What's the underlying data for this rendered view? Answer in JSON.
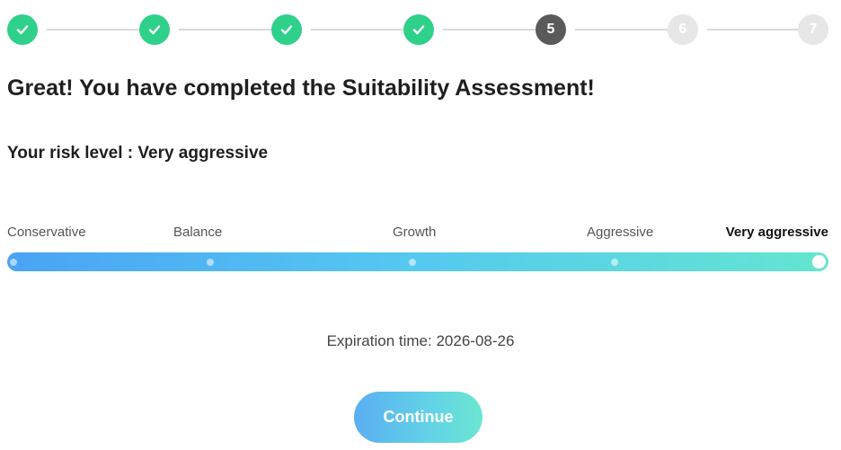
{
  "stepper": {
    "steps": [
      {
        "label": "",
        "state": "done",
        "icon": "check-icon"
      },
      {
        "label": "",
        "state": "done",
        "icon": "check-icon"
      },
      {
        "label": "",
        "state": "done",
        "icon": "check-icon"
      },
      {
        "label": "",
        "state": "done",
        "icon": "check-icon"
      },
      {
        "label": "5",
        "state": "current"
      },
      {
        "label": "6",
        "state": "todo"
      },
      {
        "label": "7",
        "state": "todo"
      }
    ]
  },
  "title": "Great! You have completed the Suitability Assessment!",
  "risk_level_text": "Your risk level : Very aggressive",
  "risk_scale": {
    "levels": [
      "Conservative",
      "Balance",
      "Growth",
      "Aggressive",
      "Very aggressive"
    ],
    "selected_index": 4,
    "selected_label": "Very aggressive"
  },
  "expiration_text": "Expiration time: 2026-08-26",
  "continue_label": "Continue",
  "colors": {
    "step_done": "#2fd08a",
    "step_current": "#5a5a5a",
    "step_todo": "#e6e6e6",
    "track_start": "#4aa3f5",
    "track_end": "#63e6cf"
  }
}
